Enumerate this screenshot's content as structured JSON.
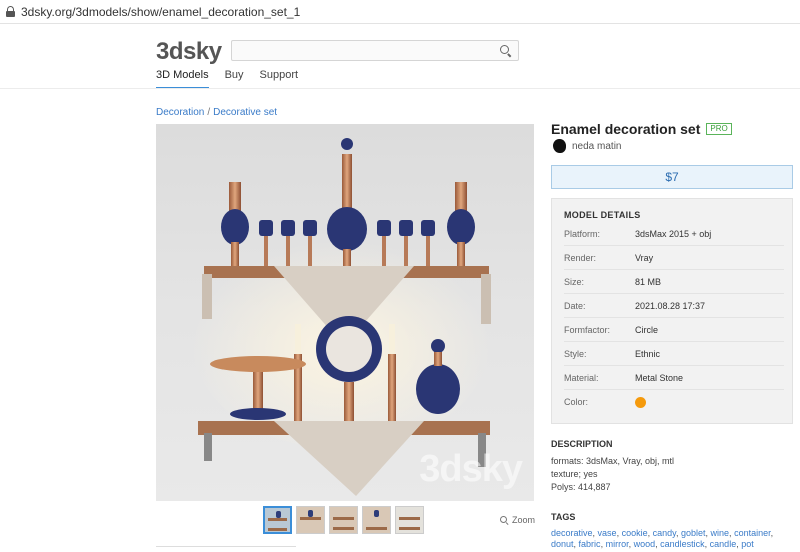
{
  "browser": {
    "url": "3dsky.org/3dmodels/show/enamel_decoration_set_1"
  },
  "header": {
    "logo": "3dsky",
    "search": {
      "placeholder": "",
      "value": ""
    },
    "nav": [
      "3D Models",
      "Buy",
      "Support"
    ]
  },
  "breadcrumb": {
    "items": [
      "Decoration",
      "Decorative set"
    ],
    "separator": "/"
  },
  "image": {
    "watermark": "3dsky",
    "thumbnail_count": 5,
    "zoom_label": "Zoom"
  },
  "product": {
    "title": "Enamel decoration set",
    "badge": "PRO",
    "author": "neda matin",
    "price": "$7"
  },
  "details": {
    "heading": "MODEL DETAILS",
    "rows": [
      {
        "label": "Platform:",
        "value": "3dsMax 2015 + obj"
      },
      {
        "label": "Render:",
        "value": "Vray"
      },
      {
        "label": "Size:",
        "value": "81 MB"
      },
      {
        "label": "Date:",
        "value": "2021.08.28 17:37"
      },
      {
        "label": "Formfactor:",
        "value": "Circle"
      },
      {
        "label": "Style:",
        "value": "Ethnic"
      },
      {
        "label": "Material:",
        "value": "Metal Stone"
      },
      {
        "label": "Color:",
        "value": ""
      }
    ],
    "color_swatch": "#f59a0c"
  },
  "description": {
    "heading": "DESCRIPTION",
    "lines": [
      "formats: 3dsMax, Vray, obj, mtl",
      "texture; yes",
      "Polys: 414,887"
    ]
  },
  "tags": {
    "heading": "TAGS",
    "items": [
      "decorative",
      "vase",
      "cookie",
      "candy",
      "goblet",
      "wine",
      "container",
      "donut",
      "fabric",
      "mirror",
      "wood",
      "candlestick",
      "candle",
      "pot"
    ]
  },
  "colors": {
    "accent": "#3b8ed8",
    "link": "#3a7bc8",
    "pro": "#3aa03a"
  }
}
